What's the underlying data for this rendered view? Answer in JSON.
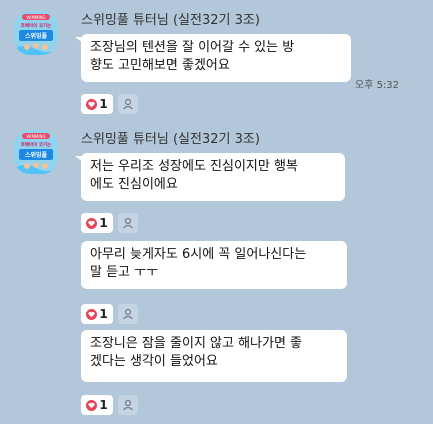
{
  "sender": "스위밍풀 튜터님 (실전32기 3조)",
  "avatar": {
    "line1": "WIMMING",
    "line2": "후배아이 코기는",
    "line3": "스위밍풀"
  },
  "messages": [
    {
      "text": "조장님의 텐션을 잘 이어갈 수 있는 방\n향도 고민해보면 좋겠어요",
      "time": "오후 5:32",
      "reaction_count": "1"
    },
    {
      "text": "저는 우리조 성장에도 진심이지만 행복\n에도 진심이에요",
      "reaction_count": "1"
    },
    {
      "text": "아무리 늦게자도 6시에 꼭 일어나신다는\n말 듣고 ㅜㅜ",
      "reaction_count": "1"
    },
    {
      "text": "조장니은 잠을 줄이지 않고 해나가면 좋\n겠다는 생각이 들었어요",
      "reaction_count": "1"
    }
  ],
  "colors": {
    "background": "#b2c7da",
    "heart": "#e2455a",
    "bubble": "#ffffff"
  },
  "icons": {
    "reaction": "heart-icon",
    "add_reaction": "person-icon"
  }
}
